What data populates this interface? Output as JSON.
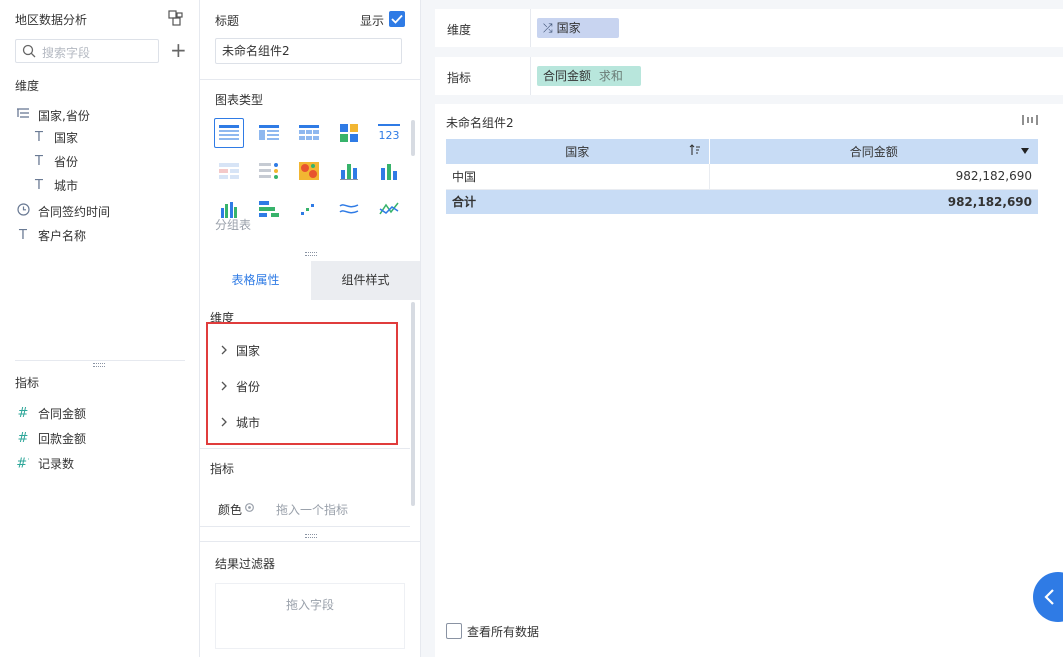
{
  "left_panel": {
    "title": "地区数据分析",
    "search_placeholder": "搜索字段",
    "dimension_label": "维度",
    "dimension_group": {
      "label": "国家,省份",
      "children": [
        "国家",
        "省份",
        "城市"
      ]
    },
    "dimension_fields": [
      {
        "label": "合同签约时间",
        "icon": "clock-icon"
      },
      {
        "label": "客户名称",
        "icon": "text-type-icon"
      }
    ],
    "metric_label": "指标",
    "metric_fields": [
      {
        "label": "合同金额",
        "icon": "hash-icon"
      },
      {
        "label": "回款金额",
        "icon": "hash-icon"
      },
      {
        "label": "记录数",
        "icon": "hash-calc-icon"
      }
    ]
  },
  "mid_panel": {
    "title_label": "标题",
    "show_label": "显示",
    "show_checked": true,
    "title_value": "未命名组件2",
    "chart_type_label": "图表类型",
    "group_table_label": "分组表",
    "tabs": [
      {
        "label": "表格属性",
        "active": true
      },
      {
        "label": "组件样式",
        "active": false
      }
    ],
    "dimension_label": "维度",
    "dimension_items": [
      "国家",
      "省份",
      "城市"
    ],
    "metric_label": "指标",
    "color_label": "颜色",
    "color_placeholder": "拖入一个指标",
    "filter_label": "结果过滤器",
    "filter_placeholder": "拖入字段"
  },
  "right_panel": {
    "dimension_label": "维度",
    "dimension_pill": "国家",
    "metric_label": "指标",
    "metric_pill": "合同金额",
    "metric_pill_agg": "求和",
    "component_title": "未命名组件2",
    "table": {
      "headers": [
        "国家",
        "合同金额"
      ],
      "rows": [
        [
          "中国",
          "982,182,690"
        ]
      ],
      "total": [
        "合计",
        "982,182,690"
      ]
    },
    "view_all_label": "查看所有数据"
  },
  "colors": {
    "accent": "#2f7be5",
    "table_header": "#c8dcf5",
    "dim_pill": "#c8d4f0",
    "metric_pill": "#b8e6dc",
    "red_highlight": "#e03c3c"
  }
}
